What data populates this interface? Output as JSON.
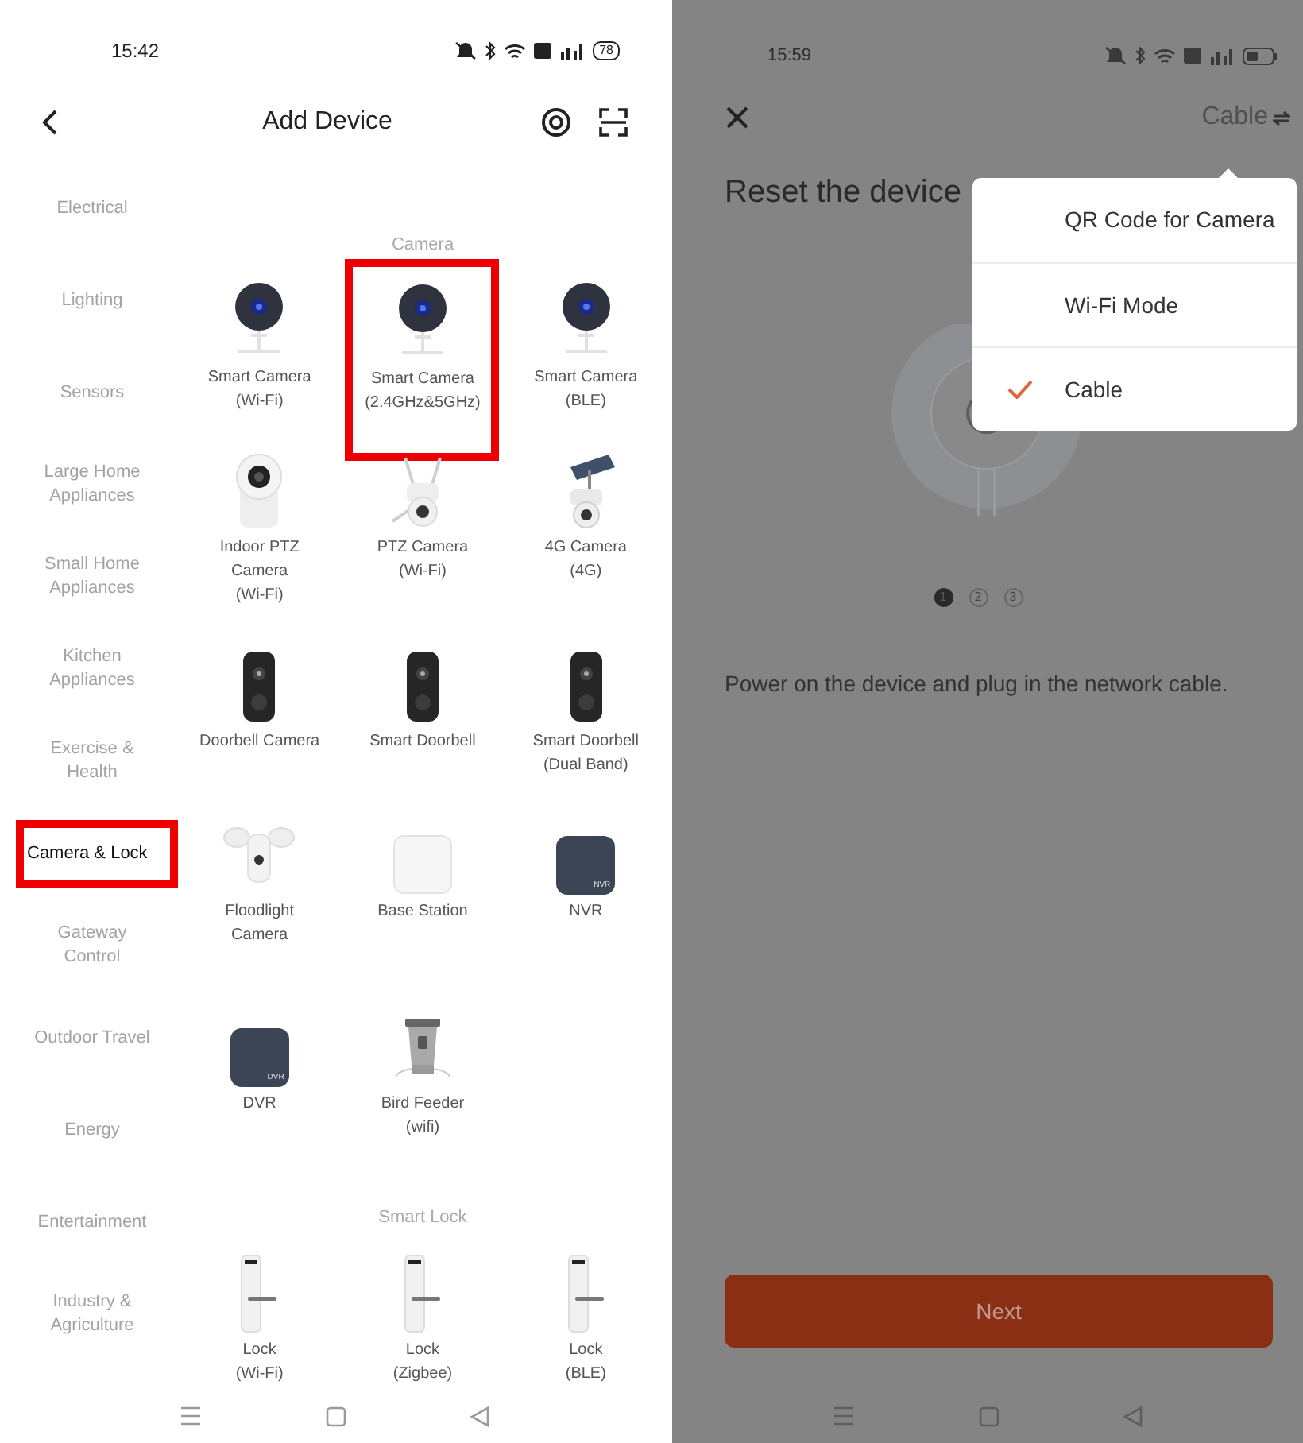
{
  "add_device_screen": {
    "status_bar": {
      "time": "15:42",
      "battery": "78"
    },
    "header": {
      "title": "Add Device"
    },
    "categories": [
      {
        "label": "Electrical",
        "selected": false,
        "highlighted": false
      },
      {
        "label": "Lighting",
        "selected": false,
        "highlighted": false
      },
      {
        "label": "Sensors",
        "selected": false,
        "highlighted": false
      },
      {
        "label": "Large Home\nAppliances",
        "selected": false,
        "highlighted": false
      },
      {
        "label": "Small Home\nAppliances",
        "selected": false,
        "highlighted": false
      },
      {
        "label": "Kitchen\nAppliances",
        "selected": false,
        "highlighted": false
      },
      {
        "label": "Exercise &\nHealth",
        "selected": false,
        "highlighted": false
      },
      {
        "label": "Camera & Lock",
        "selected": true,
        "highlighted": true
      },
      {
        "label": "Gateway\nControl",
        "selected": false,
        "highlighted": false
      },
      {
        "label": "Outdoor Travel",
        "selected": false,
        "highlighted": false
      },
      {
        "label": "Energy",
        "selected": false,
        "highlighted": false
      },
      {
        "label": "Entertainment",
        "selected": false,
        "highlighted": false
      },
      {
        "label": "Industry &\nAgriculture",
        "selected": false,
        "highlighted": false
      }
    ],
    "sections": [
      {
        "title": "Camera",
        "rows": [
          [
            {
              "label": "Smart Camera\n(Wi-Fi)",
              "kind": "dome",
              "highlighted": false
            },
            {
              "label": "Smart Camera\n(2.4GHz&5GHz)",
              "kind": "dome",
              "highlighted": true
            },
            {
              "label": "Smart Camera\n(BLE)",
              "kind": "dome",
              "highlighted": false
            }
          ],
          [
            {
              "label": "Indoor PTZ\nCamera\n(Wi-Fi)",
              "kind": "ptz",
              "highlighted": false
            },
            {
              "label": "PTZ Camera\n(Wi-Fi)",
              "kind": "outdoor",
              "highlighted": false
            },
            {
              "label": "4G Camera\n(4G)",
              "kind": "solar",
              "highlighted": false
            }
          ],
          [
            {
              "label": "Doorbell Camera",
              "kind": "doorbell",
              "highlighted": false
            },
            {
              "label": "Smart Doorbell",
              "kind": "doorbell",
              "highlighted": false
            },
            {
              "label": "Smart Doorbell\n(Dual Band)",
              "kind": "doorbell",
              "highlighted": false
            }
          ],
          [
            {
              "label": "Floodlight\nCamera",
              "kind": "floodlight",
              "highlighted": false
            },
            {
              "label": "Base Station",
              "kind": "base",
              "highlighted": false
            },
            {
              "label": "NVR",
              "kind": "recorder",
              "icon_text": "NVR",
              "highlighted": false
            }
          ],
          [
            {
              "label": "DVR",
              "kind": "recorder",
              "icon_text": "DVR",
              "highlighted": false
            },
            {
              "label": "Bird Feeder\n(wifi)",
              "kind": "feeder",
              "highlighted": false
            }
          ]
        ]
      },
      {
        "title": "Smart Lock",
        "rows": [
          [
            {
              "label": "Lock\n(Wi-Fi)",
              "kind": "lock",
              "highlighted": false
            },
            {
              "label": "Lock\n(Zigbee)",
              "kind": "lock",
              "highlighted": false
            },
            {
              "label": "Lock\n(BLE)",
              "kind": "lock",
              "highlighted": false
            }
          ]
        ]
      }
    ]
  },
  "reset_screen": {
    "status_bar": {
      "time": "15:59"
    },
    "header": {
      "mode": "Cable"
    },
    "title": "Reset the device",
    "steps": [
      {
        "label": "1",
        "selected": true
      },
      {
        "label": "2",
        "selected": false
      },
      {
        "label": "3",
        "selected": false
      }
    ],
    "description": "Power on the device and plug in the network cable.",
    "button": "Next",
    "menu": {
      "items": [
        {
          "label": "QR Code for Camera",
          "selected": false
        },
        {
          "label": "Wi-Fi Mode",
          "selected": false
        },
        {
          "label": "Cable",
          "selected": true
        }
      ]
    }
  }
}
